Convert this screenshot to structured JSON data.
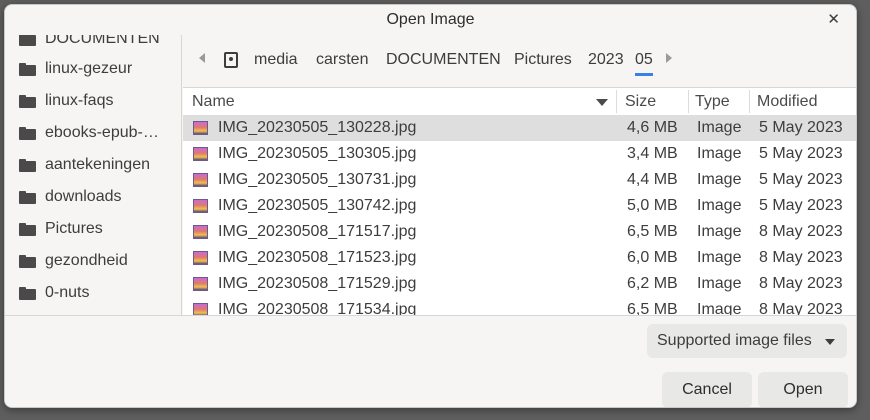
{
  "window": {
    "title": "Open Image",
    "close": "✕"
  },
  "sidebar": {
    "partial_top": "DOCUMENTEN",
    "items": [
      {
        "label": "linux-gezeur"
      },
      {
        "label": "linux-faqs"
      },
      {
        "label": "ebooks-epub-…"
      },
      {
        "label": "aantekeningen"
      },
      {
        "label": "downloads"
      },
      {
        "label": "Pictures"
      },
      {
        "label": "gezondheid"
      },
      {
        "label": "0-nuts"
      }
    ]
  },
  "pathbar": {
    "crumbs": [
      "media",
      "carsten",
      "DOCUMENTEN",
      "Pictures",
      "2023",
      "05"
    ],
    "current": "05"
  },
  "filelist": {
    "columns": {
      "name": "Name",
      "size": "Size",
      "type": "Type",
      "modified": "Modified"
    },
    "rows": [
      {
        "name": "IMG_20230505_130228.jpg",
        "size": "4,6 MB",
        "type": "Image",
        "modified": "5 May 2023"
      },
      {
        "name": "IMG_20230505_130305.jpg",
        "size": "3,4 MB",
        "type": "Image",
        "modified": "5 May 2023"
      },
      {
        "name": "IMG_20230505_130731.jpg",
        "size": "4,4 MB",
        "type": "Image",
        "modified": "5 May 2023"
      },
      {
        "name": "IMG_20230505_130742.jpg",
        "size": "5,0 MB",
        "type": "Image",
        "modified": "5 May 2023"
      },
      {
        "name": "IMG_20230508_171517.jpg",
        "size": "6,5 MB",
        "type": "Image",
        "modified": "8 May 2023"
      },
      {
        "name": "IMG_20230508_171523.jpg",
        "size": "6,0 MB",
        "type": "Image",
        "modified": "8 May 2023"
      },
      {
        "name": "IMG_20230508_171529.jpg",
        "size": "6,2 MB",
        "type": "Image",
        "modified": "8 May 2023"
      },
      {
        "name": "IMG_20230508_171534.jpg",
        "size": "6,5 MB",
        "type": "Image",
        "modified": "8 May 2023"
      }
    ]
  },
  "footer": {
    "filter": "Supported image files",
    "cancel": "Cancel",
    "open": "Open"
  },
  "colors": {
    "accent": "#3584e4",
    "selection": "#dedede"
  }
}
